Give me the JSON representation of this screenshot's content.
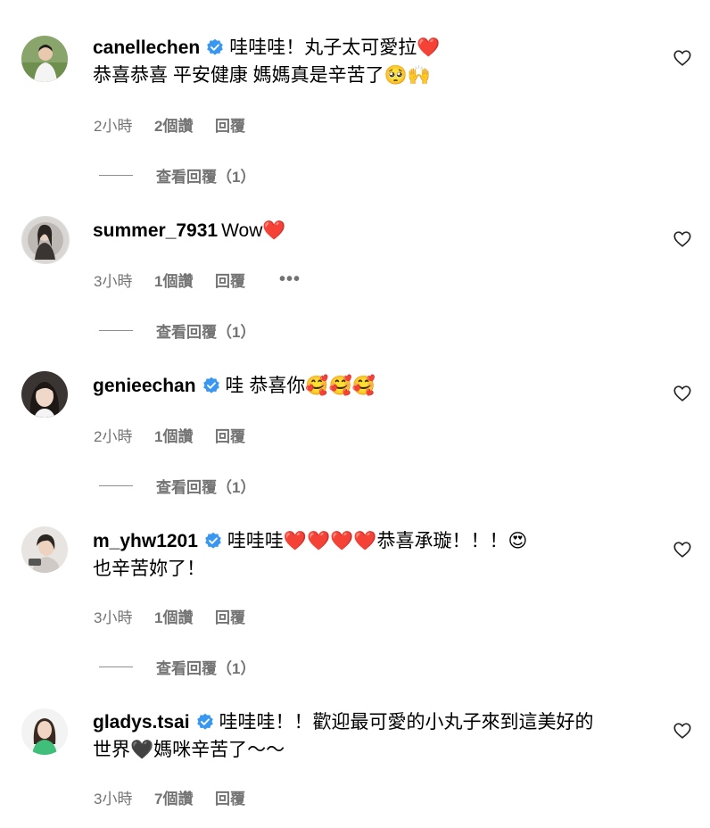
{
  "comments": [
    {
      "username": "canellechen",
      "verified": true,
      "text_lines": [
        "哇哇哇！丸子太可愛拉❤️",
        "恭喜恭喜 平安健康 媽媽真是辛苦了🥺🙌"
      ],
      "time": "2小時",
      "likes": "2個讚",
      "reply": "回覆",
      "view_replies": "查看回覆（1）"
    },
    {
      "username": "summer_7931",
      "verified": false,
      "text_lines": [
        "Wow❤️"
      ],
      "time": "3小時",
      "likes": "1個讚",
      "reply": "回覆",
      "more": "•••",
      "view_replies": "查看回覆（1）"
    },
    {
      "username": "genieechan",
      "verified": true,
      "text_lines": [
        "哇 恭喜你🥰🥰🥰"
      ],
      "time": "2小時",
      "likes": "1個讚",
      "reply": "回覆",
      "view_replies": "查看回覆（1）"
    },
    {
      "username": "m_yhw1201",
      "verified": true,
      "text_lines": [
        "哇哇哇❤️❤️❤️❤️恭喜承璇！！！😍",
        "也辛苦妳了！"
      ],
      "time": "3小時",
      "likes": "1個讚",
      "reply": "回覆",
      "view_replies": "查看回覆（1）"
    },
    {
      "username": "gladys.tsai",
      "verified": true,
      "text_lines": [
        "哇哇哇！！歡迎最可愛的小丸子來到這美好的",
        "世界🖤媽咪辛苦了～～"
      ],
      "time": "3小時",
      "likes": "7個讚",
      "reply": "回覆"
    }
  ],
  "colors": {
    "verified": "#3897f0",
    "meta": "#737373"
  },
  "icons": {
    "like": "heart-outline-icon",
    "verified": "verified-badge-icon",
    "more": "more-options-icon"
  }
}
